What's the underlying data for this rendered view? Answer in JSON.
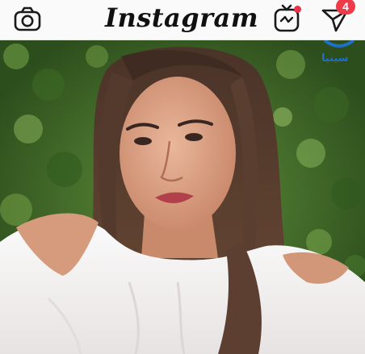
{
  "app": {
    "logo_text": "Instagram",
    "notifications": {
      "direct_count": "4"
    },
    "icons": {
      "camera": "camera-icon",
      "igtv": "igtv-icon",
      "direct": "direct-message-icon",
      "igtv_dot": "notification-dot"
    },
    "colors": {
      "badge": "#ee3b4a",
      "topbar_bg": "#fafafa",
      "watermark": "#1f6fc4"
    }
  },
  "post": {
    "image": "selfie-photo",
    "watermark_text": "سينيا"
  }
}
